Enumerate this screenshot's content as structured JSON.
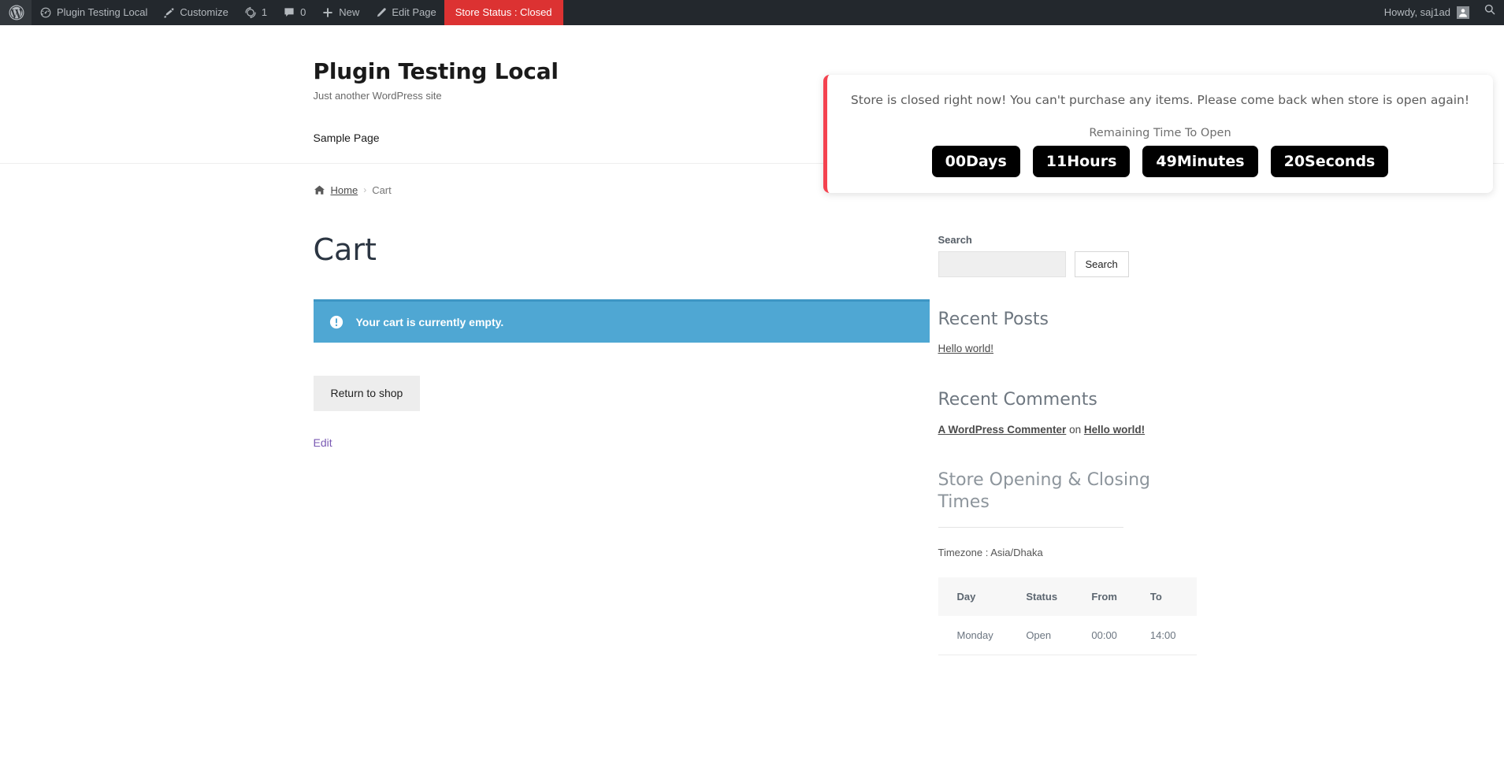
{
  "adminbar": {
    "logo_icon": "wordpress-logo-icon",
    "site_item": {
      "label": "Plugin Testing Local",
      "icon": "dashboard-speedometer-icon"
    },
    "customize": {
      "label": "Customize",
      "icon": "paintbrush-icon"
    },
    "updates": {
      "count": "1",
      "icon": "update-arrows-icon"
    },
    "comments": {
      "count": "0",
      "icon": "comment-bubble-icon"
    },
    "new": {
      "label": "New",
      "icon": "plus-icon"
    },
    "edit_page": {
      "label": "Edit Page",
      "icon": "pencil-icon"
    },
    "store_status": {
      "label": "Store Status : Closed",
      "color": "#dc3232"
    },
    "howdy": {
      "label": "Howdy, saj1ad",
      "avatar_icon": "user-avatar-icon"
    },
    "search": {
      "icon": "search-icon"
    }
  },
  "site": {
    "title": "Plugin Testing Local",
    "description": "Just another WordPress site",
    "nav": [
      {
        "label": "Sample Page"
      }
    ]
  },
  "store_notice": {
    "message": "Store is closed right now! You can't purchase any items. Please come back when store is open again!",
    "subtitle": "Remaining Time To Open",
    "accent_color": "#f4424f",
    "countdown": [
      {
        "value": "00",
        "unit": "Days",
        "text": "00Days"
      },
      {
        "value": "11",
        "unit": "Hours",
        "text": "11Hours"
      },
      {
        "value": "49",
        "unit": "Minutes",
        "text": "49Minutes"
      },
      {
        "value": "20",
        "unit": "Seconds",
        "text": "20Seconds"
      }
    ]
  },
  "breadcrumb": {
    "home_icon": "home-icon",
    "home_label": "Home",
    "separator": "›",
    "current": "Cart"
  },
  "main": {
    "page_title": "Cart",
    "notice": {
      "icon": "info-exclamation-icon",
      "text": "Your cart is currently empty.",
      "background": "#4fa7d3"
    },
    "return_to_shop": "Return to shop",
    "edit_link": "Edit"
  },
  "sidebar": {
    "search_widget": {
      "label": "Search",
      "input_value": "",
      "placeholder": "",
      "button_label": "Search"
    },
    "recent_posts": {
      "title": "Recent Posts",
      "items": [
        {
          "label": "Hello world!"
        }
      ]
    },
    "recent_comments": {
      "title": "Recent Comments",
      "items": [
        {
          "author": "A WordPress Commenter",
          "on": "on",
          "post": "Hello world!"
        }
      ]
    },
    "store_hours": {
      "title": "Store Opening & Closing Times",
      "timezone": "Timezone : Asia/Dhaka",
      "columns": [
        "Day",
        "Status",
        "From",
        "To"
      ],
      "rows": [
        {
          "day": "Monday",
          "status": "Open",
          "from": "00:00",
          "to": "14:00"
        }
      ]
    }
  }
}
